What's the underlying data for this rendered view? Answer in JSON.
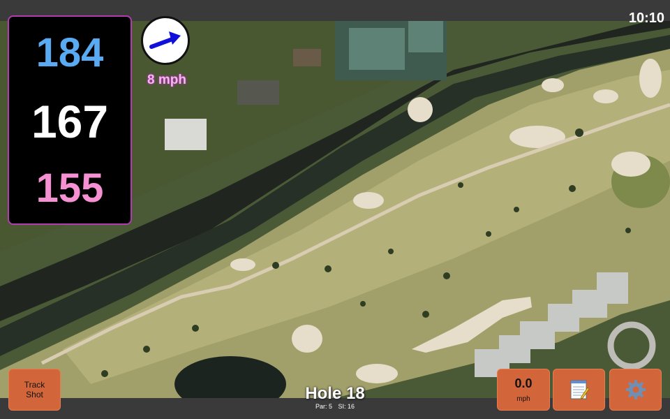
{
  "status": {
    "time": "10:10"
  },
  "distances": {
    "back": "184",
    "middle": "167",
    "front": "155"
  },
  "wind": {
    "speed_label": "8 mph",
    "arrow_icon": "arrow-right-icon"
  },
  "hole": {
    "title": "Hole 18",
    "par": "Par: 5",
    "si": "SI: 16"
  },
  "buttons": {
    "track_line1": "Track",
    "track_line2": "Shot",
    "speed_value": "0.0",
    "speed_unit": "mph",
    "notes_icon": "notepad-icon",
    "settings_icon": "gear-icon"
  },
  "colors": {
    "back_distance": "#59aaf2",
    "front_distance": "#f590d2",
    "button_orange": "#d2663a",
    "panel_border": "#b03cb0"
  }
}
